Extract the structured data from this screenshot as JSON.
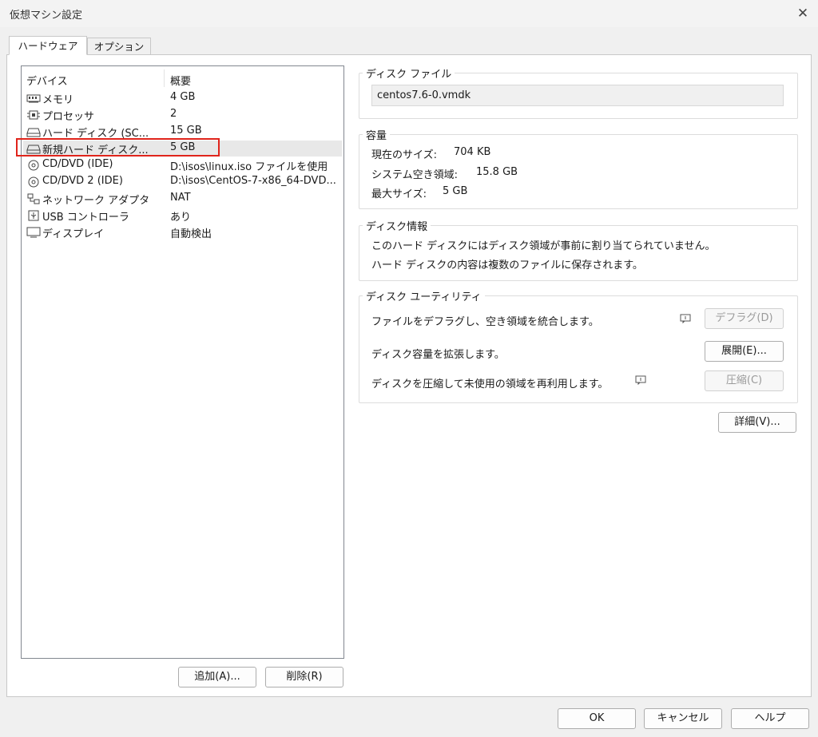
{
  "window": {
    "title": "仮想マシン設定",
    "close_icon": "close-icon"
  },
  "tabs": [
    {
      "label": "ハードウェア",
      "active": true
    },
    {
      "label": "オプション",
      "active": false
    }
  ],
  "device_list": {
    "columns": {
      "device": "デバイス",
      "summary": "概要"
    },
    "rows": [
      {
        "icon": "memory-icon",
        "name": "メモリ",
        "summary": "4 GB"
      },
      {
        "icon": "processor-icon",
        "name": "プロセッサ",
        "summary": "2"
      },
      {
        "icon": "hard-disk-icon",
        "name": "ハード ディスク (SC...",
        "summary": "15 GB"
      },
      {
        "icon": "hard-disk-icon",
        "name": "新規ハード ディスク...",
        "summary": "5 GB",
        "selected": true
      },
      {
        "icon": "cd-dvd-icon",
        "name": "CD/DVD (IDE)",
        "summary": "D:\\isos\\linux.iso ファイルを使用"
      },
      {
        "icon": "cd-dvd-icon",
        "name": "CD/DVD 2 (IDE)",
        "summary": "D:\\isos\\CentOS-7-x86_64-DVD..."
      },
      {
        "icon": "network-icon",
        "name": "ネットワーク アダプタ",
        "summary": "NAT"
      },
      {
        "icon": "usb-icon",
        "name": "USB コントローラ",
        "summary": "あり"
      },
      {
        "icon": "display-icon",
        "name": "ディスプレイ",
        "summary": "自動検出"
      }
    ],
    "add_button": "追加(A)...",
    "remove_button": "削除(R)"
  },
  "disk_file": {
    "legend": "ディスク ファイル",
    "value": "centos7.6-0.vmdk"
  },
  "capacity": {
    "legend": "容量",
    "current_size_label": "現在のサイズ:",
    "current_size_value": "704 KB",
    "free_space_label": "システム空き領域:",
    "free_space_value": "15.8 GB",
    "max_size_label": "最大サイズ:",
    "max_size_value": "5 GB"
  },
  "disk_info": {
    "legend": "ディスク情報",
    "line1": "このハード ディスクにはディスク領域が事前に割り当てられていません。",
    "line2": "ハード ディスクの内容は複数のファイルに保存されます。"
  },
  "utilities": {
    "legend": "ディスク ユーティリティ",
    "defrag_text": "ファイルをデフラグし、空き領域を統合します。",
    "defrag_button": "デフラグ(D)",
    "expand_text": "ディスク容量を拡張します。",
    "expand_button": "展開(E)...",
    "compact_text": "ディスクを圧縮して未使用の領域を再利用します。",
    "compact_button": "圧縮(C)"
  },
  "advanced_button": "詳細(V)...",
  "footer": {
    "ok": "OK",
    "cancel": "キャンセル",
    "help": "ヘルプ"
  }
}
